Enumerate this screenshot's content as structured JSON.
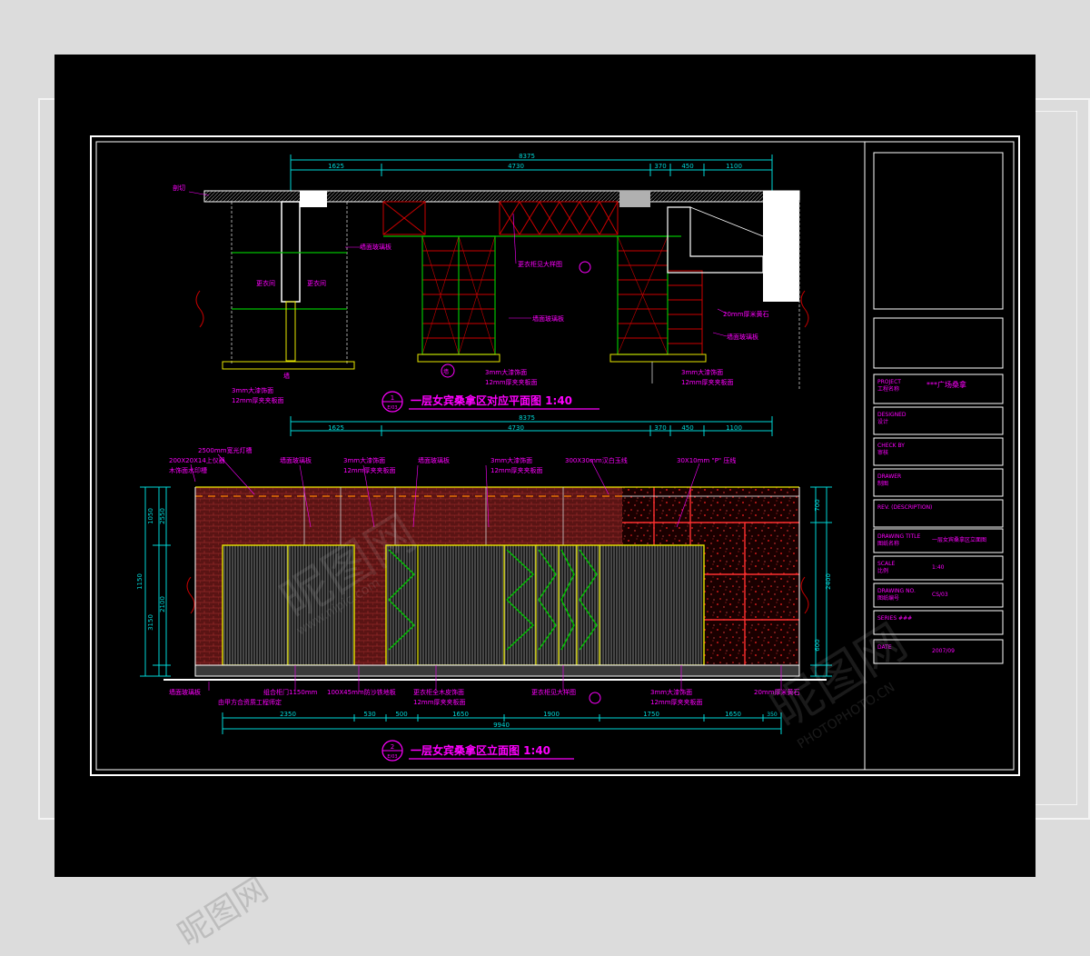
{
  "colors": {
    "background": "#000000",
    "frame": "#ffffff",
    "dimension": "#00d8d8",
    "annotation": "#ff00ff",
    "structure": "#e8e800",
    "brace": "#d00000",
    "section_green": "#00c000"
  },
  "plan": {
    "title": "一层女宾桑拿区对应平面图 1:40",
    "index_no": "1",
    "index_sheet": "E/03",
    "overall_dim": "8375",
    "dims": [
      "1625",
      "4730",
      "370",
      "450",
      "1100"
    ],
    "wall_label": "剖切",
    "room_left": "更衣间",
    "room_right": "更衣间",
    "wall_char": "墙",
    "arrow_char": "墙",
    "notes": [
      "墙面玻璃板",
      "更衣柜见大样图",
      "墙面玻璃板",
      "20mm厚米黄石",
      "墙面玻璃板",
      "3mm大漆饰面",
      "12mm厚夹夹板面",
      "3mm大漆饰面",
      "12mm厚夹夹板面",
      "3mm大漆饰面",
      "12mm厚夹夹板面"
    ]
  },
  "elevation": {
    "title": "一层女宾桑拿区立面图 1:40",
    "index_no": "2",
    "index_sheet": "E/03",
    "top_dim": "8375",
    "top_dims": [
      "1625",
      "4730",
      "370",
      "450",
      "1100"
    ],
    "bottom_dims": [
      "2350",
      "530",
      "500",
      "1650",
      "1900",
      "1750",
      "1650",
      "350"
    ],
    "bottom_total": "9940",
    "left_dims": [
      "1050",
      "1150",
      "3150",
      "2100",
      "2550"
    ],
    "right_dims": [
      "700",
      "2400",
      "600"
    ],
    "top_notes": [
      "2500mm宽光灯槽",
      "200X20X14上仪器",
      "木饰面水印槽",
      "墙面玻璃板",
      "3mm大漆饰面",
      "12mm厚夹夹板面",
      "墙面玻璃板",
      "3mm大漆饰面",
      "12mm厚夹夹板面",
      "300X30mm汉白玉线",
      "30X10mm \"P\" 压线"
    ],
    "bottom_notes": [
      "墙面玻璃板",
      "组合柜门1150mm",
      "由甲方合资质工程师定",
      "100X45mm防沙铁地板",
      "更衣柜全木皮饰面",
      "12mm厚夹夹板面",
      "更衣柜见大样图",
      "3mm大漆饰面",
      "12mm厚夹夹板面",
      "20mm厚米黄石"
    ]
  },
  "title_block": {
    "rows": [
      {
        "label": "PROJECT\n工程名称",
        "value": "***广场桑拿"
      },
      {
        "label": "DESIGNED\n设计",
        "value": ""
      },
      {
        "label": "CHECK BY\n审核",
        "value": ""
      },
      {
        "label": "DRAWER\n制图",
        "value": ""
      },
      {
        "label": "REV. (DESCRIPTION)",
        "value": ""
      },
      {
        "label": "DRAWING TITLE\n图纸名称",
        "value": "一层女宾桑拿区立面图"
      },
      {
        "label": "SCALE\n比例",
        "value": "1:40"
      },
      {
        "label": "DRAWING NO.\n图纸编号",
        "value": "CS/03"
      },
      {
        "label": "SERIES ###",
        "value": ""
      },
      {
        "label": "DATE",
        "value": "2007/09"
      }
    ]
  },
  "watermark": {
    "brand": "昵图网",
    "site": "www.nipic.com",
    "code": "PHOTOPHOTO.CN"
  }
}
